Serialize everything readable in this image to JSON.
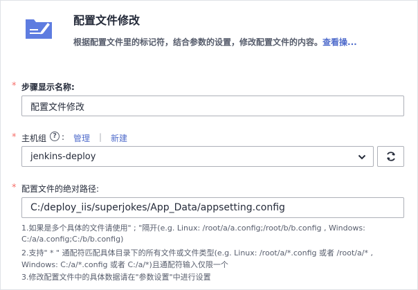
{
  "header": {
    "title": "配置文件修改",
    "description": "根据配置文件里的标记符，结合参数的设置，修改配置文件的内容。",
    "more_link": "查看操..."
  },
  "colors": {
    "required": "#f66f6a",
    "link": "#526ecc",
    "icon_bg": "#5e7ce0"
  },
  "step_name": {
    "required_mark": "*",
    "label": "步骤显示名称:",
    "value": "配置文件修改"
  },
  "host_group": {
    "required_mark": "*",
    "label": "主机组",
    "help_icon": "?",
    "colon": ":",
    "manage_link": "管理",
    "separator": "|",
    "create_link": "新建",
    "selected": "jenkins-deploy",
    "refresh_icon": "refresh-icon"
  },
  "config_path": {
    "required_mark": "*",
    "label": "配置文件的绝对路径:",
    "value": "C:/deploy_iis/superjokes/App_Data/appsetting.config",
    "hints": [
      "1.如果是多个具体的文件请使用\" ; \"隔开(e.g. Linux: /root/a/a.config;/root/b/b.config , Windows:",
      "C:/a/a.config;C:/b/b.config)",
      "2.支持\" * \" 通配符匹配具体目录下的所有文件或文件类型(e.g. Linux: /root/a/*.config 或者 /root/a/* ,",
      "Windows: C:/a/*.config 或者 C:/a/*)且通配符输入仅限一个",
      "3.修改配置文件中的具体数据请在\"参数设置\"中进行设置"
    ]
  }
}
